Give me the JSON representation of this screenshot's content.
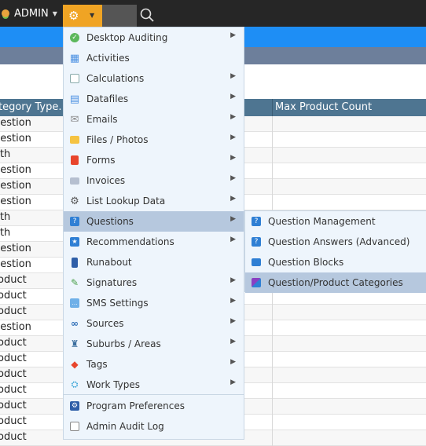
{
  "topbar": {
    "user_label": "ADMIN"
  },
  "table": {
    "col_category": "tegory Type.",
    "col_max_count": "Max Product Count",
    "rows": [
      "uestion",
      "uestion",
      "oth",
      "uestion",
      "uestion",
      "uestion",
      "oth",
      "oth",
      "uestion",
      "uestion",
      "roduct",
      "roduct",
      "roduct",
      "uestion",
      "roduct",
      "roduct",
      "roduct",
      "roduct",
      "roduct",
      "roduct",
      "roduct"
    ]
  },
  "menu": {
    "items": [
      {
        "label": "Desktop Auditing",
        "icon": "check-circle-icon",
        "submenu": true
      },
      {
        "label": "Activities",
        "icon": "grid-icon",
        "submenu": false
      },
      {
        "label": "Calculations",
        "icon": "calculator-icon",
        "submenu": true
      },
      {
        "label": "Datafiles",
        "icon": "table-icon",
        "submenu": true
      },
      {
        "label": "Emails",
        "icon": "envelope-icon",
        "submenu": true
      },
      {
        "label": "Files / Photos",
        "icon": "folder-icon",
        "submenu": true
      },
      {
        "label": "Forms",
        "icon": "pdf-icon",
        "submenu": true
      },
      {
        "label": "Invoices",
        "icon": "invoice-icon",
        "submenu": true
      },
      {
        "label": "List Lookup Data",
        "icon": "gear-icon",
        "submenu": true
      },
      {
        "label": "Questions",
        "icon": "question-icon",
        "submenu": true
      },
      {
        "label": "Recommendations",
        "icon": "recommendation-icon",
        "submenu": true
      },
      {
        "label": "Runabout",
        "icon": "phone-icon",
        "submenu": false
      },
      {
        "label": "Signatures",
        "icon": "pen-icon",
        "submenu": true
      },
      {
        "label": "SMS Settings",
        "icon": "sms-icon",
        "submenu": true
      },
      {
        "label": "Sources",
        "icon": "link-icon",
        "submenu": true
      },
      {
        "label": "Suburbs / Areas",
        "icon": "pin-icon",
        "submenu": true
      },
      {
        "label": "Tags",
        "icon": "tag-icon",
        "submenu": true
      },
      {
        "label": "Work Types",
        "icon": "hierarchy-icon",
        "submenu": true
      },
      {
        "label": "Program Preferences",
        "icon": "settings-icon",
        "submenu": false
      },
      {
        "label": "Admin Audit Log",
        "icon": "log-icon",
        "submenu": false
      }
    ]
  },
  "submenu": {
    "items": [
      {
        "label": "Question Management",
        "icon": "question-icon"
      },
      {
        "label": "Question Answers (Advanced)",
        "icon": "question-icon"
      },
      {
        "label": "Question Blocks",
        "icon": "blocks-icon"
      },
      {
        "label": "Question/Product Categories",
        "icon": "category-icon"
      }
    ]
  },
  "colors": {
    "accent": "#f0a424",
    "topbar": "#262626",
    "blue_band": "#1e8ef5",
    "header": "#4e7591",
    "menu_bg": "#eef5fc",
    "highlight": "#b6c8de"
  }
}
